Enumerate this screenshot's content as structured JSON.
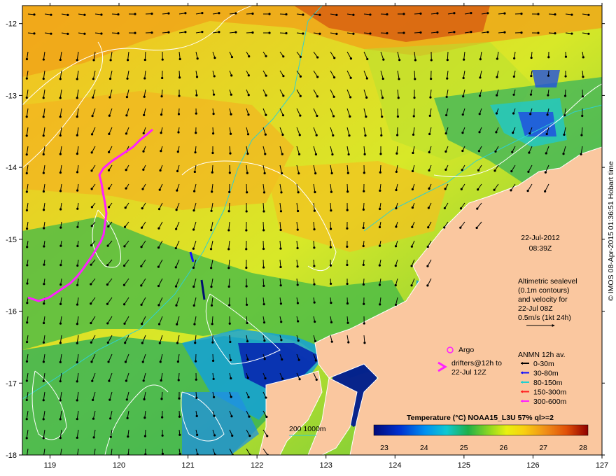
{
  "axes": {
    "x_ticks": [
      "119",
      "120",
      "121",
      "122",
      "123",
      "124",
      "125",
      "126",
      "127"
    ],
    "y_ticks": [
      "-12",
      "-13",
      "-14",
      "-15",
      "-16",
      "-17",
      "-18"
    ]
  },
  "timestamp": {
    "date": "22-Jul-2012",
    "time": "08:39Z"
  },
  "altimetry_note": {
    "line1": "Altimetric sealevel",
    "line2": "(0.1m contours)",
    "line3": "and velocity for",
    "line4": "22-Jul 08Z",
    "line5": "0.5m/s (1kt 24h)"
  },
  "legend": {
    "argo_label": "Argo",
    "drifters_line1": "drifters@12h to",
    "drifters_line2": "22-Jul 12Z",
    "anmn_title": "ANMN 12h av.",
    "depth_bins": [
      {
        "label": "0-30m",
        "color": "#000000"
      },
      {
        "label": "30-80m",
        "color": "#1010ff"
      },
      {
        "label": "80-150m",
        "color": "#20d0d0"
      },
      {
        "label": "150-300m",
        "color": "#ff2020"
      },
      {
        "label": "300-600m",
        "color": "#ff20ff"
      }
    ]
  },
  "colorbar": {
    "title": "Temperature (°C) NOAA15_L3U 57% ql>=2",
    "ticks": [
      "23",
      "24",
      "25",
      "26",
      "27",
      "28"
    ]
  },
  "isobath_label": "200  1000m",
  "credit": "© IMOS 08-Apr-2015 01:36:51 Hobart time",
  "colors": {
    "land": "#fac79f",
    "drifter": "#ff20ff",
    "isobath_200": "#30d0d0",
    "sealevel_contour": "#ffffff"
  }
}
